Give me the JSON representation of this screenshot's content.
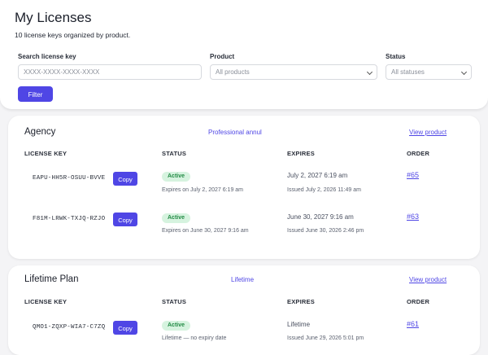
{
  "header": {
    "title": "My Licenses",
    "subtitle": "10 license keys organized by product."
  },
  "filters": {
    "search_label": "Search license key",
    "search_placeholder": "XXXX-XXXX-XXXX-XXXX",
    "product_label": "Product",
    "product_value": "All products",
    "status_label": "Status",
    "status_value": "All statuses",
    "filter_button": "Filter"
  },
  "columns": {
    "key": "LICENSE KEY",
    "status": "STATUS",
    "expires": "EXPIRES",
    "order": "ORDER"
  },
  "copy_label": "Copy",
  "products": [
    {
      "name": "Agency",
      "plan": "Professional annul",
      "view_label": "View product",
      "licenses": [
        {
          "key": "EAPU-HH5R-OSUU-BVVE",
          "status": "Active",
          "status_note": "Expires on July 2, 2027 6:19 am",
          "expires": "July 2, 2027 6:19 am",
          "issued": "Issued July 2, 2026 11:49 am",
          "order": "#65"
        },
        {
          "key": "F81M-LRWK-TXJQ-RZJO",
          "status": "Active",
          "status_note": "Expires on June 30, 2027 9:16 am",
          "expires": "June 30, 2027 9:16 am",
          "issued": "Issued June 30, 2026 2:46 pm",
          "order": "#63"
        }
      ]
    },
    {
      "name": "Lifetime Plan",
      "plan": "Lifetime",
      "view_label": "View product",
      "licenses": [
        {
          "key": "QMO1-ZQXP-WIA7-C7ZQ",
          "status": "Active",
          "status_note": "Lifetime — no expiry date",
          "expires": "Lifetime",
          "issued": "Issued June 29, 2026 5:01 pm",
          "order": "#61"
        }
      ]
    }
  ],
  "colors": {
    "accent": "#4f46e5",
    "badge_bg": "#d6f3df",
    "badge_text": "#238b45"
  }
}
